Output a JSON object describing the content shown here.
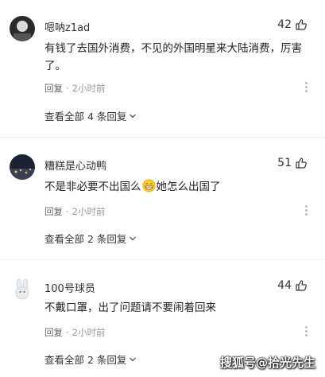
{
  "comments": [
    {
      "username": "嗯呐z1ad",
      "likes": "42",
      "text": "有钱了去国外消费，不见的外国明星来大陆消费，厉害了。",
      "reply_label": "回复",
      "time": "2小时前",
      "view_all": "查看全部 4 条回复"
    },
    {
      "username": "糟糕是心动鸭",
      "likes": "51",
      "text_before_emoji": "不是非必要不出国么",
      "text_after_emoji": "她怎么出国了",
      "reply_label": "回复",
      "time": "2小时前",
      "view_all": "查看全部 2 条回复"
    },
    {
      "username": "100号球员",
      "likes": "44",
      "text": "不戴口罩，出了问题请不要闹着回来",
      "reply_label": "回复",
      "time": "2小时前",
      "view_all": "查看全部 2 条回复"
    }
  ],
  "meta_separator": "·",
  "watermark": "搜狐号@拾光先生",
  "icons": {
    "like": "thumbs-up-icon",
    "more": "vertical-ellipsis-icon",
    "expand": "chevron-down-icon",
    "emoji": "grinning-face-emoji"
  }
}
